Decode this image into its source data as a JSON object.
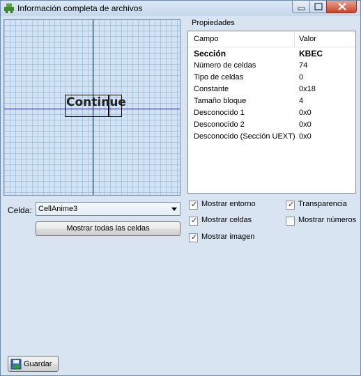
{
  "window": {
    "title": "Información completa de archivos"
  },
  "preview": {
    "cell_text": "Continue"
  },
  "properties": {
    "group_label": "Propiedades",
    "columns": {
      "field": "Campo",
      "value": "Valor"
    },
    "rows": [
      {
        "field": "Sección",
        "value": "KBEC",
        "bold": true
      },
      {
        "field": "Número de celdas",
        "value": "74"
      },
      {
        "field": "Tipo de celdas",
        "value": "0"
      },
      {
        "field": "Constante",
        "value": "0x18"
      },
      {
        "field": "Tamaño bloque",
        "value": "4"
      },
      {
        "field": "Desconocido 1",
        "value": "0x0"
      },
      {
        "field": "Desconocido 2",
        "value": "0x0"
      },
      {
        "field": "Desconocido (Sección UEXT)",
        "value": "0x0"
      }
    ]
  },
  "cell_selector": {
    "label": "Celda:",
    "selected": "CellAnime3",
    "show_all_label": "Mostrar todas las celdas"
  },
  "options": {
    "mostrar_entorno": {
      "label": "Mostrar entorno",
      "checked": true
    },
    "transparencia": {
      "label": "Transparencia",
      "checked": true
    },
    "mostrar_celdas": {
      "label": "Mostrar celdas",
      "checked": true
    },
    "mostrar_numeros": {
      "label": "Mostrar números",
      "checked": false
    },
    "mostrar_imagen": {
      "label": "Mostrar imagen",
      "checked": true
    },
    "check_glyph": "✓"
  },
  "actions": {
    "save_label": "Guardar"
  }
}
